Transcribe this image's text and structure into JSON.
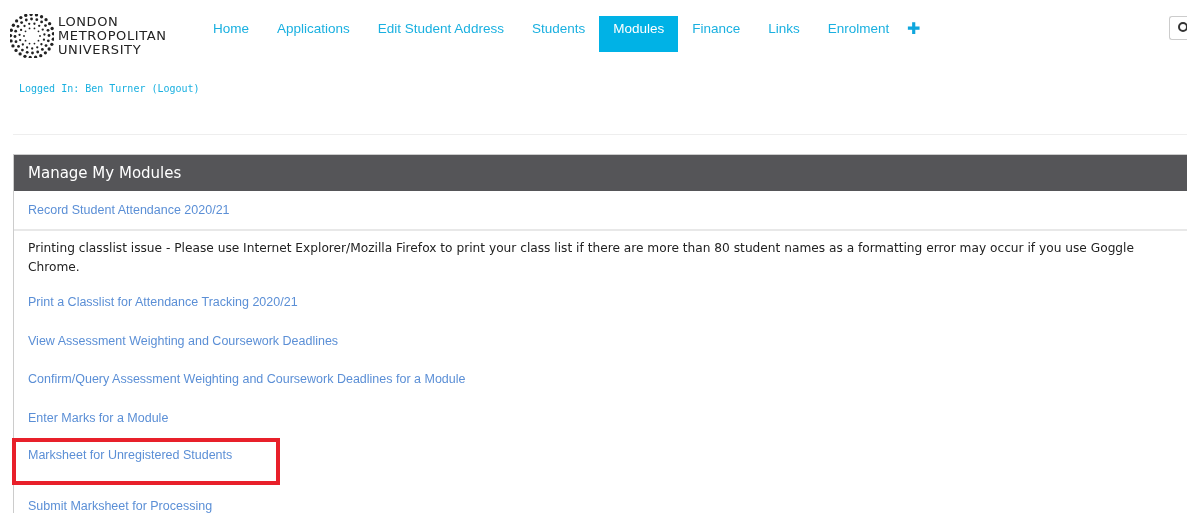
{
  "logo": {
    "lines": [
      "LONDON",
      "METROPOLITAN",
      "UNIVERSITY"
    ]
  },
  "nav": {
    "items": [
      {
        "label": "Home",
        "selected": false
      },
      {
        "label": "Applications",
        "selected": false
      },
      {
        "label": "Edit Student Address",
        "selected": false
      },
      {
        "label": "Students",
        "selected": false
      },
      {
        "label": "Modules",
        "selected": true
      },
      {
        "label": "Finance",
        "selected": false
      },
      {
        "label": "Links",
        "selected": false
      },
      {
        "label": "Enrolment",
        "selected": false
      }
    ],
    "plus": "✚"
  },
  "login": "Logged In: Ben Turner (Logout)",
  "panel": {
    "title": "Manage My Modules",
    "rows": [
      {
        "kind": "link",
        "text": "Record Student Attendance 2020/21",
        "highlighted": false
      },
      {
        "kind": "text",
        "text": "Printing classlist issue - Please use Internet Explorer/Mozilla Firefox to print your class list if there are more than 80 student names as a formatting error may occur if you use Goggle Chrome.",
        "highlighted": false
      },
      {
        "kind": "link",
        "text": "Print a Classlist for Attendance Tracking 2020/21",
        "highlighted": false
      },
      {
        "kind": "link",
        "text": "View Assessment Weighting and Coursework Deadlines",
        "highlighted": false
      },
      {
        "kind": "link",
        "text": "Confirm/Query Assessment Weighting and Coursework Deadlines for a Module",
        "highlighted": false
      },
      {
        "kind": "link",
        "text": "Enter Marks for a Module",
        "highlighted": false
      },
      {
        "kind": "link",
        "text": "Marksheet for Unregistered Students",
        "highlighted": true
      },
      {
        "kind": "link",
        "text": "Submit Marksheet for Processing",
        "highlighted": false
      }
    ]
  }
}
